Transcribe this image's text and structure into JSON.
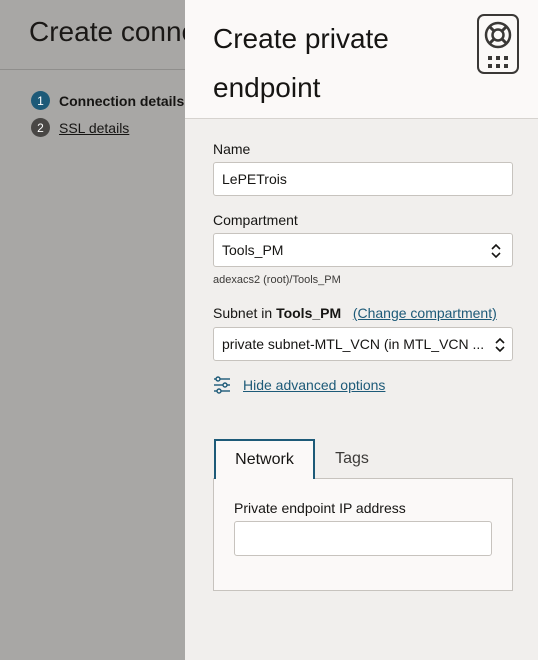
{
  "background": {
    "title": "Create conne",
    "steps": [
      {
        "number": "1",
        "label": "Connection details"
      },
      {
        "number": "2",
        "label": "SSL details"
      }
    ]
  },
  "panel": {
    "title": "Create private endpoint",
    "help_icon": "lifebuoy-icon",
    "grid_icon": "grid-dots-icon",
    "name_label": "Name",
    "name_value": "LePETrois",
    "compartment_label": "Compartment",
    "compartment_value": "Tools_PM",
    "compartment_path": "adexacs2 (root)/Tools_PM",
    "subnet_label_prefix": "Subnet in",
    "subnet_compartment": "Tools_PM",
    "change_compartment": "(Change compartment)",
    "subnet_value": "private subnet-MTL_VCN (in MTL_VCN ...",
    "advanced_options": "Hide advanced options",
    "tabs": [
      {
        "label": "Network",
        "selected": true
      },
      {
        "label": "Tags",
        "selected": false
      }
    ],
    "ip_label": "Private endpoint IP address",
    "ip_value": ""
  },
  "colors": {
    "accent": "#1d5a78",
    "overlay": "#a8a7a5",
    "panel": "#f1efed"
  }
}
